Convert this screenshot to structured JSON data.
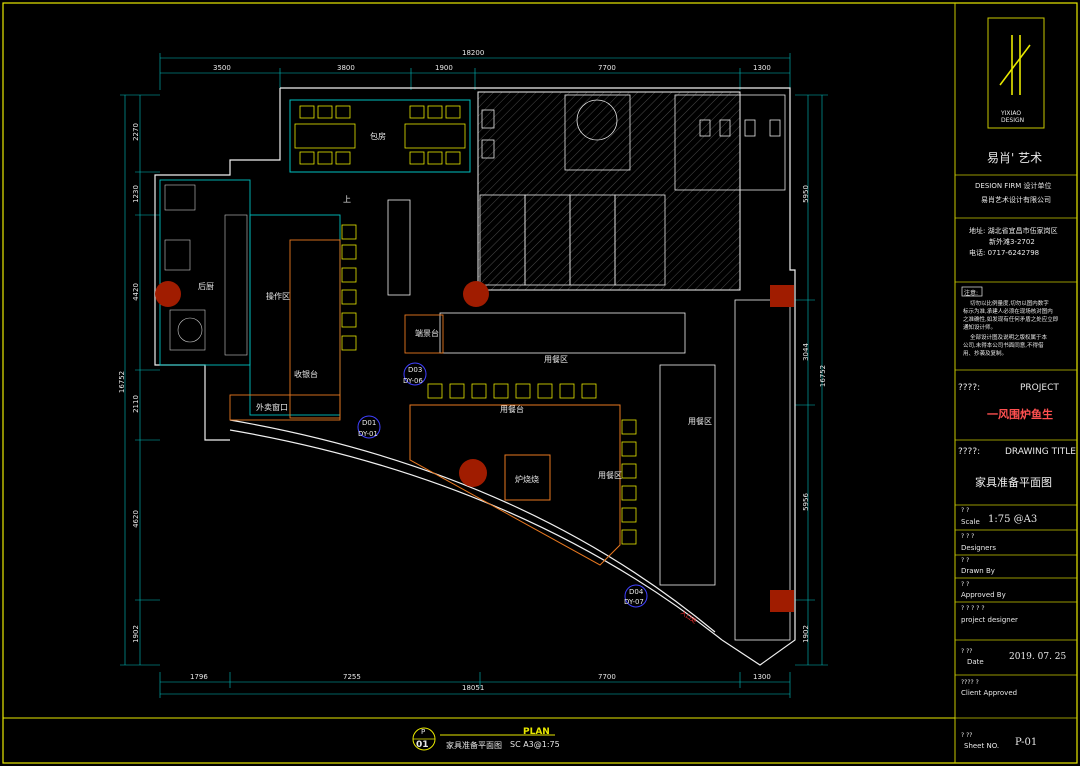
{
  "plan": {
    "dims_top": [
      "18200",
      "3500",
      "3800",
      "1900",
      "7700",
      "1300"
    ],
    "dims_bottom": [
      "1796",
      "7255",
      "7700",
      "1300",
      "18051"
    ],
    "dims_left": [
      "2270",
      "1230",
      "4420",
      "2110",
      "4620",
      "1902",
      "16752"
    ],
    "dims_right": [
      "5950",
      "3044",
      "5956",
      "1902",
      "16752"
    ],
    "rooms": {
      "private_room": "包房",
      "kitchen": "后厨",
      "operation": "操作区",
      "cashier": "收银台",
      "takeout": "外卖窗口",
      "dining_center": "用餐区",
      "dining_right": "用餐区",
      "dining_lower": "用餐区",
      "dining_counter": "用餐台",
      "serving": "端景台",
      "grill": "炉烧烧",
      "up": "上",
      "entrance": "入口处"
    },
    "markers": [
      {
        "id": "D01",
        "sub": "DY-01"
      },
      {
        "id": "D03",
        "sub": "DY-06"
      },
      {
        "id": "D04",
        "sub": "DY-07"
      }
    ]
  },
  "footer": {
    "plan_label": "PLAN",
    "circle_top": "P",
    "circle_bottom": "01",
    "drawing_name": "家具准备平面图",
    "scale_text": "SC A3@1:75"
  },
  "titleblock": {
    "logo_line1": "YIXIAO",
    "logo_line2": "DESIGN",
    "firm_cn": "易肖' 艺术",
    "firm_label": "DESION FIRM  设计单位",
    "firm_name": "易肖艺术设计有限公司",
    "address": "地址: 湖北省宜昌市伍家岗区",
    "address2": "新外滩3-2702",
    "phone": "电话: 0717-6242798",
    "notes_title": "注意:",
    "notes": [
      "切勿以比例量度,切勿以图内数字",
      "标示为准,承建人必须在现场核对图内",
      "之准确性,如发现有任何矛盾之处应立即",
      "通知设计师。",
      "全部设计图及说明之版权属于本",
      "公司,未得本公司书面同意,不得借",
      "用、抄袭及复制。"
    ],
    "project_label": "????:",
    "project_en": "PROJECT",
    "project_name": "一风围炉鱼生",
    "title_label": "????:",
    "title_en": "DRAWING TITLE",
    "drawing_title": "家具准备平面图",
    "scale_q": "? ?",
    "scale_label": "Scale",
    "scale_value": "1:75 @A3",
    "designers_q": "? ? ?",
    "designers_label": "Designers",
    "drawn_q": "? ?",
    "drawn_label": "Drawn By",
    "approved_q": "? ?",
    "approved_label": "Approved By",
    "pd_q": "? ? ? ? ?",
    "pd_label": "project designer",
    "date_q": "?  ??",
    "date_label": "Date",
    "date_value": "2019. 07. 25",
    "client_q": "???? ?",
    "client_label": "Client Approved",
    "sheet_q": "? ??",
    "sheet_label": "Sheet NO.",
    "sheet_value": "P-01"
  }
}
